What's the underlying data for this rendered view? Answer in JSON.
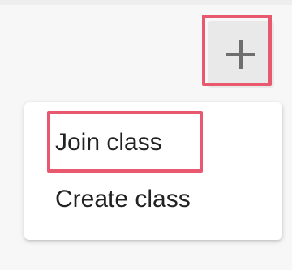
{
  "add_button": {
    "icon": "plus-icon",
    "icon_glyph": "+"
  },
  "menu": {
    "items": [
      {
        "label": "Join class"
      },
      {
        "label": "Create class"
      }
    ]
  },
  "colors": {
    "highlight": "#e8586e",
    "icon": "#6e6e6e",
    "menu_text": "#222222",
    "button_bg": "#e9e9e9"
  }
}
